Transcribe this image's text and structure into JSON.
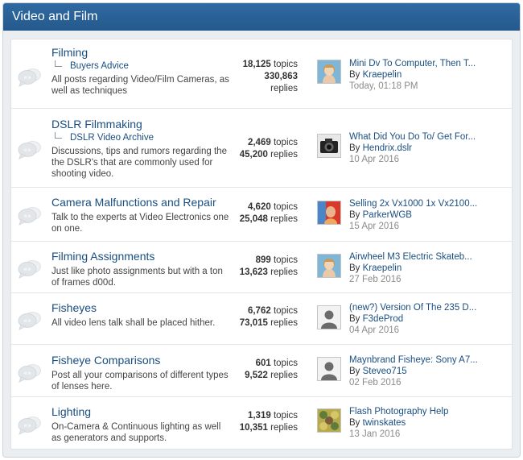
{
  "section": {
    "title": "Video and Film"
  },
  "forums": [
    {
      "title": "Filming",
      "subforum": "Buyers Advice",
      "description": "All posts regarding Video/Film Cameras, as well as techniques",
      "topics": "18,125",
      "topics_label": "topics",
      "replies": "330,863",
      "replies_label": "replies",
      "last_thread": "Mini Dv To Computer, Then T...",
      "by_label": "By",
      "last_user": "Kraepelin",
      "last_date": "Today, 01:18 PM",
      "avatar_icon": "user-photo-avatar"
    },
    {
      "title": "DSLR Filmmaking",
      "subforum": "DSLR Video Archive",
      "description": "Discussions, tips and rumors regarding the the DSLR's that are commonly used for shooting video.",
      "topics": "2,469",
      "topics_label": "topics",
      "replies": "45,200",
      "replies_label": "replies",
      "last_thread": "What Did You Do To/ Get For...",
      "by_label": "By",
      "last_user": "Hendrix.dslr",
      "last_date": "10 Apr 2016",
      "avatar_icon": "camera-photo-avatar"
    },
    {
      "title": "Camera Malfunctions and Repair",
      "subforum": "",
      "description": "Talk to the experts at Video Electronics one on one.",
      "topics": "4,620",
      "topics_label": "topics",
      "replies": "25,048",
      "replies_label": "replies",
      "last_thread": "Selling 2x Vx1000 1x Vx2100...",
      "by_label": "By",
      "last_user": "ParkerWGB",
      "last_date": "15 Apr 2016",
      "avatar_icon": "portrait-photo-avatar"
    },
    {
      "title": "Filming Assignments",
      "subforum": "",
      "description": "Just like photo assignments but with a ton of frames d00d.",
      "topics": "899",
      "topics_label": "topics",
      "replies": "13,623",
      "replies_label": "replies",
      "last_thread": "Airwheel M3 Electric Skateb...",
      "by_label": "By",
      "last_user": "Kraepelin",
      "last_date": "27 Feb 2016",
      "avatar_icon": "user-photo-avatar"
    },
    {
      "title": "Fisheyes",
      "subforum": "",
      "description": "All video lens talk shall be placed hither.",
      "topics": "6,762",
      "topics_label": "topics",
      "replies": "73,015",
      "replies_label": "replies",
      "last_thread": "(new?) Version Of The 235 D...",
      "by_label": "By",
      "last_user": "F3deProd",
      "last_date": "04 Apr 2016",
      "avatar_icon": "default-user-icon"
    },
    {
      "title": "Fisheye Comparisons",
      "subforum": "",
      "description": "Post all your comparisons of different types of lenses here.",
      "topics": "601",
      "topics_label": "topics",
      "replies": "9,522",
      "replies_label": "replies",
      "last_thread": "Maynbrand Fisheye: Sony A7...",
      "by_label": "By",
      "last_user": "Steveo715",
      "last_date": "02 Feb 2016",
      "avatar_icon": "default-user-icon"
    },
    {
      "title": "Lighting",
      "subforum": "",
      "description": "On-Camera & Continuous lighting as well as generators and supports.",
      "topics": "1,319",
      "topics_label": "topics",
      "replies": "10,351",
      "replies_label": "replies",
      "last_thread": "Flash Photography Help",
      "by_label": "By",
      "last_user": "twinskates",
      "last_date": "13 Jan 2016",
      "avatar_icon": "pattern-avatar"
    }
  ]
}
